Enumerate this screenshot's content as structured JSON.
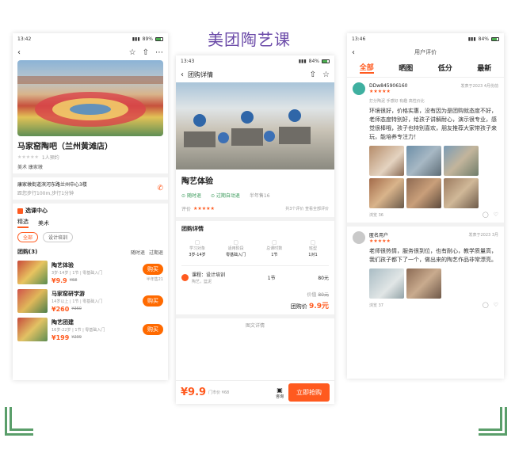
{
  "main_title": "美团陶艺课",
  "phone1": {
    "status_time": "13:42",
    "status_batt": "89%",
    "shop_name": "马家窑陶吧（兰州黄滩店）",
    "booked": "1人预约",
    "category": "美术  康家墩",
    "address": "康家墩街道滨河东路兰州中心3楼",
    "distance": "距您步行100m,步行1分钟",
    "section_center": "选课中心",
    "tabs": [
      "精选",
      "美术"
    ],
    "filters": [
      "全部",
      "设计培训"
    ],
    "group_header": "团购(3)",
    "group_tags": [
      "随时退",
      "过期退"
    ],
    "items": [
      {
        "title": "陶艺体验",
        "sub": "3岁-14岁 | 1节 | 零基础入门",
        "price": "¥9.9",
        "old": "¥68",
        "buy": "购买",
        "sold": "半年售21"
      },
      {
        "title": "马家窑研学游",
        "sub": "14岁以上 | 1节 | 零基础入门",
        "price": "¥260",
        "old": "¥360",
        "buy": "购买",
        "sold": ""
      },
      {
        "title": "陶艺团建",
        "sub": "16岁-22岁 | 1节 | 零基础入门",
        "price": "¥199",
        "old": "¥299",
        "buy": "购买",
        "sold": ""
      }
    ]
  },
  "phone2": {
    "status_time": "13:43",
    "status_batt": "84%",
    "nav_title": "团购详情",
    "product_title": "陶艺体验",
    "guarantees": [
      "随时退",
      "过期自动退",
      "半年售16"
    ],
    "rating_label": "评价",
    "rating_more": "共3个评价 查看全部评价",
    "detail_header": "团购详情",
    "specs": [
      {
        "label": "学习对象",
        "value": "3岁-14岁"
      },
      {
        "label": "适用阶段",
        "value": "零基础入门"
      },
      {
        "label": "总课时数",
        "value": "1节"
      },
      {
        "label": "班型",
        "value": "1对1"
      }
    ],
    "course_name": "课程：设计培训",
    "course_sub": "陶艺，篮泥",
    "course_count": "1节",
    "course_price": "80元",
    "value_label": "价值",
    "value_amount": "80元",
    "group_price_label": "团购价",
    "group_price": "9.9元",
    "image_detail": "图文详情",
    "bottom_price": "¥9.9",
    "bottom_old": "门市价 ¥68",
    "consult": "咨询",
    "buy_now": "立即抢购"
  },
  "phone3": {
    "status_time": "13:46",
    "status_batt": "84%",
    "nav_title": "用户评价",
    "tabs": [
      "全部",
      "晒图",
      "低分",
      "最新"
    ],
    "review1": {
      "user": "DDw845906160",
      "date": "发表于2023 4月份前",
      "sub": "打分陶泥  手感好  有趣  高性价比",
      "text": "环境很好，价格实惠，没有因为是团购就态度不好，老师态度特别好，给孩子讲解耐心，演示很专业，感觉很棒哦，孩子也特别喜欢，朋友推荐大家带孩子来玩，能培养专注力！",
      "views": "浏览 36"
    },
    "review2": {
      "user": "匿名用户",
      "date": "发表于2023 3月",
      "text": "老师很热情，服务很到位，也有耐心，教学质量高，我们孩子都下了一个，做出来的陶艺作品非常漂亮。",
      "views": "浏览 37"
    }
  },
  "colors": {
    "accent": "#ff5a1f",
    "title": "#6b4aa8",
    "corner": "#5a9e6a"
  }
}
